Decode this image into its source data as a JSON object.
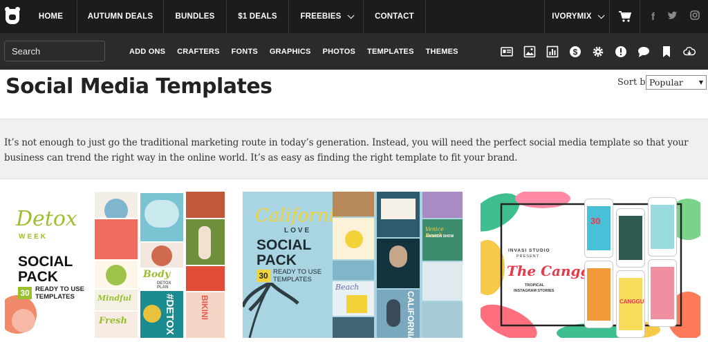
{
  "nav": {
    "items": [
      {
        "label": "HOME"
      },
      {
        "label": "AUTUMN DEALS"
      },
      {
        "label": "BUNDLES"
      },
      {
        "label": "$1 DEALS"
      },
      {
        "label": "FREEBIES"
      },
      {
        "label": "CONTACT"
      }
    ],
    "account_label": "IVORYMIX",
    "social": [
      "f",
      "t",
      "o"
    ]
  },
  "subnav": {
    "search_placeholder": "Search",
    "categories": [
      "ADD ONS",
      "CRAFTERS",
      "FONTS",
      "GRAPHICS",
      "PHOTOS",
      "TEMPLATES",
      "THEMES"
    ],
    "icons": [
      "id-card-icon",
      "image-icon",
      "bar-chart-icon",
      "dollar-icon",
      "gear-icon",
      "alert-icon",
      "chat-icon",
      "bookmark-icon",
      "cloud-download-icon"
    ]
  },
  "page": {
    "title": "Social Media Templates",
    "sort_label": "Sort by",
    "sort_value": "Popular",
    "description": "It’s not enough to just go the traditional marketing route in today’s generation. Instead, you will need the perfect social media template so that your business can trend the right way in the online world. It’s as easy as finding the right template to fit your brand."
  },
  "products": [
    {
      "script_line1": "Detox",
      "script_line2": "WEEK",
      "headline1": "SOCIAL",
      "headline2": "PACK",
      "count": "30",
      "sub1": "READY TO USE",
      "sub2": "TEMPLATES",
      "tile_texts": [
        "Body",
        "DETOX PLAN",
        "Fresh",
        "#DETOX",
        "Mindful",
        "BIKINI"
      ]
    },
    {
      "script_line1": "California",
      "script_line2": "LOVE",
      "headline1": "SOCIAL",
      "headline2": "PACK",
      "count": "30",
      "sub1": "READY TO USE",
      "sub2": "TEMPLATES",
      "tile_texts": [
        "Venice Beach",
        "FASHION SHOW",
        "CALIFORNIA",
        "Beach"
      ]
    },
    {
      "studio": "INVASI STUDIO",
      "present": "PRESENT",
      "script_title": "The Canggu",
      "tagline1": "TROPICAL",
      "tagline2": "INSTAGRAM STORIES",
      "tile_texts": [
        "30",
        "CANGGU"
      ]
    }
  ],
  "colors": {
    "topbar": "#1c1c1c",
    "subbar": "#2b2b2b",
    "detox_green": "#9bbf2f",
    "california_yellow": "#f3d23a"
  }
}
